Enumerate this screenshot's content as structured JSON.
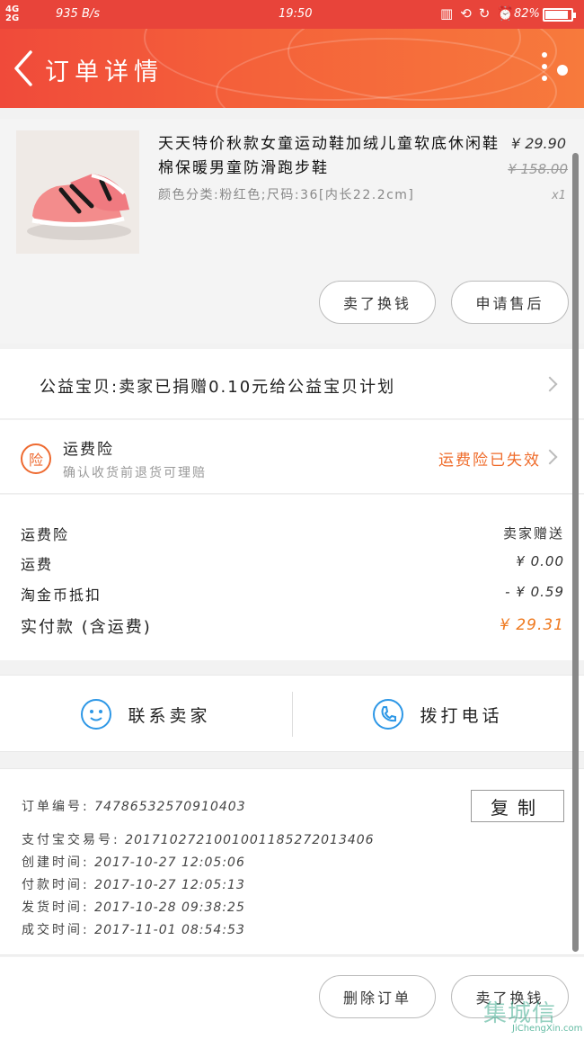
{
  "status_bar": {
    "signal_top": "4G",
    "signal_bottom": "2G",
    "speed": "935 B/s",
    "time": "19:50",
    "battery": "82%",
    "battery_level": 0.82
  },
  "header": {
    "title": "订单详情"
  },
  "product": {
    "name": "天天特价秋款女童运动鞋加绒儿童软底休闲鞋棉保暖男童防滑跑步鞋",
    "sku": "颜色分类:粉红色;尺码:36[内长22.2cm]",
    "price": "¥ 29.90",
    "original_price": "¥ 158.00",
    "quantity": "x1",
    "btn_sell": "卖了换钱",
    "btn_after_sale": "申请售后"
  },
  "charity": {
    "text": "公益宝贝:卖家已捐赠0.10元给公益宝贝计划"
  },
  "insurance": {
    "badge": "险",
    "title": "运费险",
    "subtitle": "确认收货前退货可理赔",
    "status": "运费险已失效"
  },
  "fees": {
    "rows": [
      {
        "label": "运费险",
        "value": "卖家赠送"
      },
      {
        "label": "运费",
        "value": "¥ 0.00"
      },
      {
        "label": "淘金币抵扣",
        "value": "- ¥ 0.59"
      }
    ],
    "total_label": "实付款 (含运费)",
    "total_value": "¥ 29.31"
  },
  "contact": {
    "seller_label": "联系卖家",
    "call_label": "拨打电话"
  },
  "order_info": {
    "order_no_label": "订单编号:",
    "order_no": "74786532570910403",
    "copy_label": "复制",
    "alipay_label": "支付宝交易号:",
    "alipay_no": "2017102721001001185272013406",
    "created_label": "创建时间:",
    "created": "2017-10-27 12:05:06",
    "paid_label": "付款时间:",
    "paid": "2017-10-27 12:05:13",
    "shipped_label": "发货时间:",
    "shipped": "2017-10-28 09:38:25",
    "done_label": "成交时间:",
    "done": "2017-11-01 08:54:53"
  },
  "footer": {
    "delete_label": "删除订单",
    "sell_label": "卖了换钱"
  },
  "watermark": {
    "big": "集城信",
    "small": "JiChengXin.com"
  },
  "colors": {
    "header": "#f04a3a",
    "accent_orange": "#ef6b2a",
    "contact_blue": "#2d97e6"
  }
}
